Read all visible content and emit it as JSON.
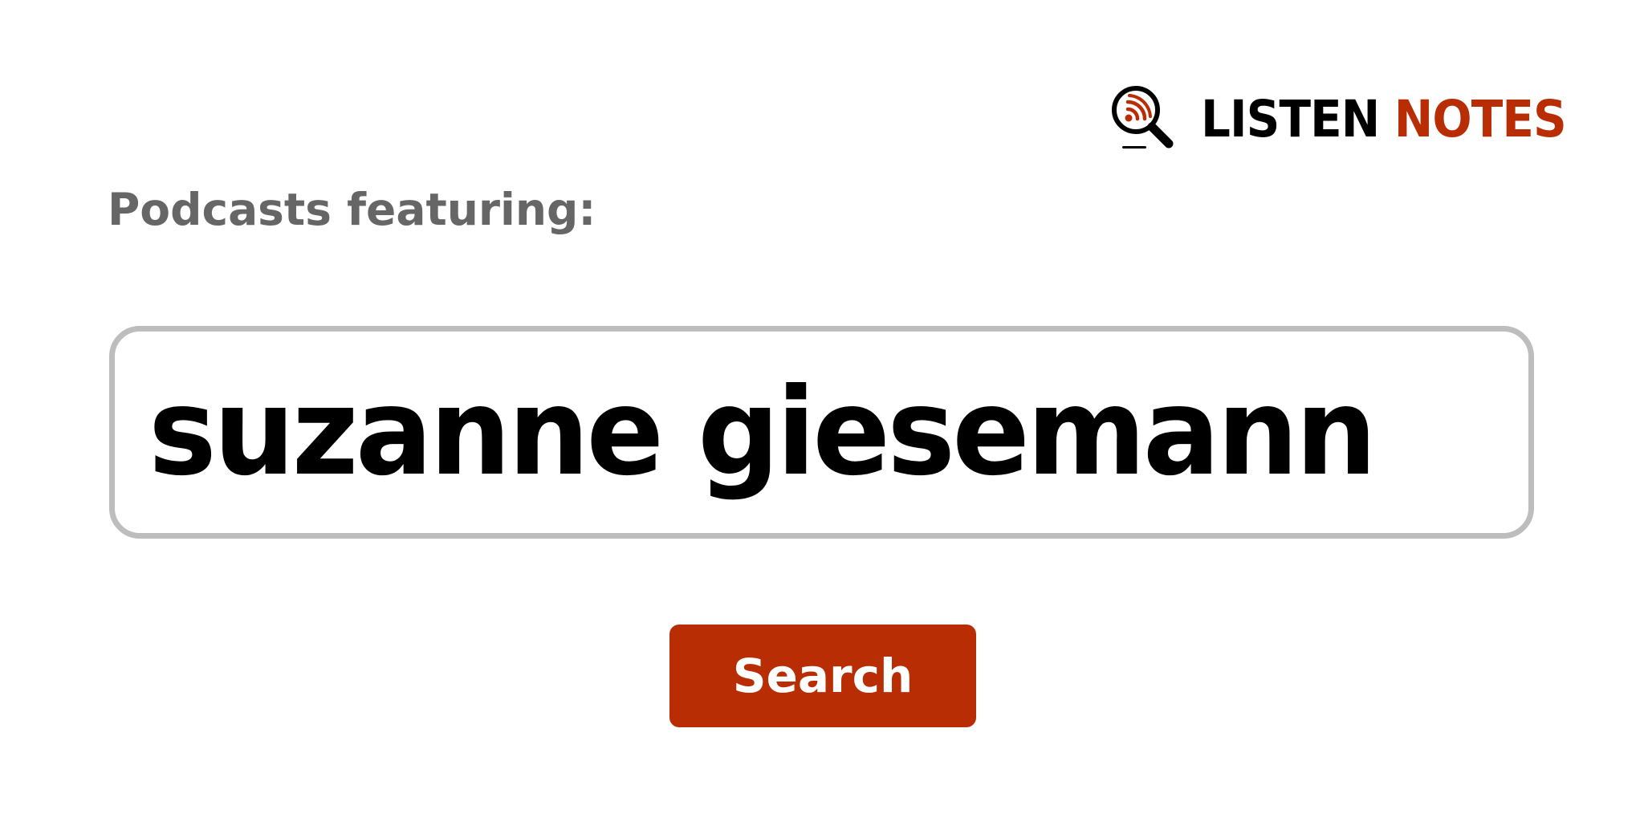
{
  "brand": {
    "word1": "LISTEN",
    "word2": "NOTES",
    "icon": "podcast-magnifier-icon",
    "color_dark": "#000000",
    "color_accent": "#b92d04"
  },
  "subtitle": "Podcasts featuring:",
  "search": {
    "value": "suzanne giesemann",
    "border_color": "#bdbdbd"
  },
  "button": {
    "label": "Search",
    "background": "#b92d04",
    "text_color": "#ffffff"
  },
  "subtitle_color": "#666666"
}
